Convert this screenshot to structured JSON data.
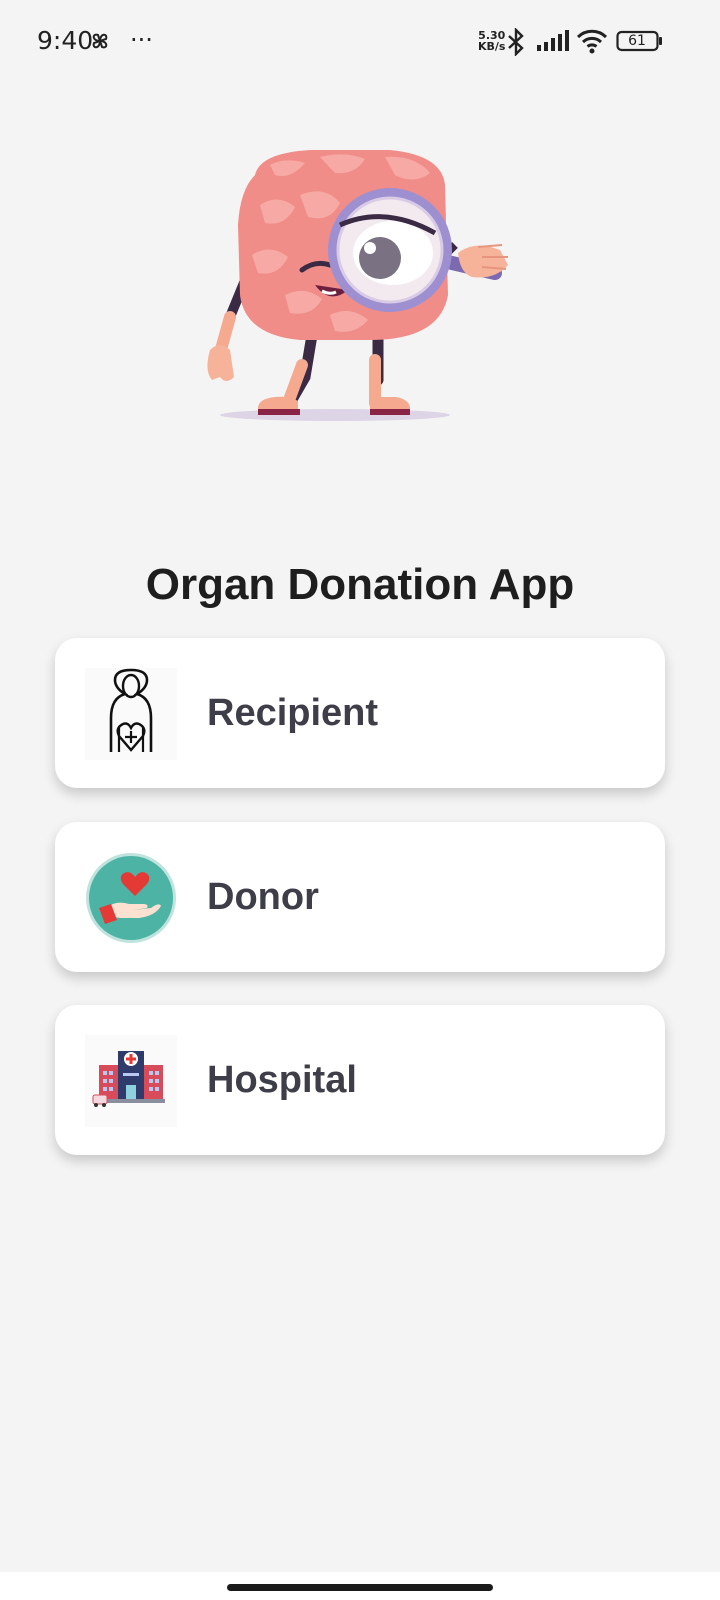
{
  "status_bar": {
    "time": "9:40",
    "more": "···",
    "speed_value": "5.30",
    "speed_unit": "KB/s",
    "battery": "61"
  },
  "title": "Organ Donation App",
  "options": [
    {
      "label": "Recipient",
      "icon": "recipient-icon"
    },
    {
      "label": "Donor",
      "icon": "donor-icon"
    },
    {
      "label": "Hospital",
      "icon": "hospital-icon"
    }
  ],
  "colors": {
    "background": "#f4f4f4",
    "card": "#ffffff",
    "label": "#3e3e48",
    "title": "#1e1e1e",
    "donor_circle": "#4db3a5",
    "heart": "#e53935"
  }
}
